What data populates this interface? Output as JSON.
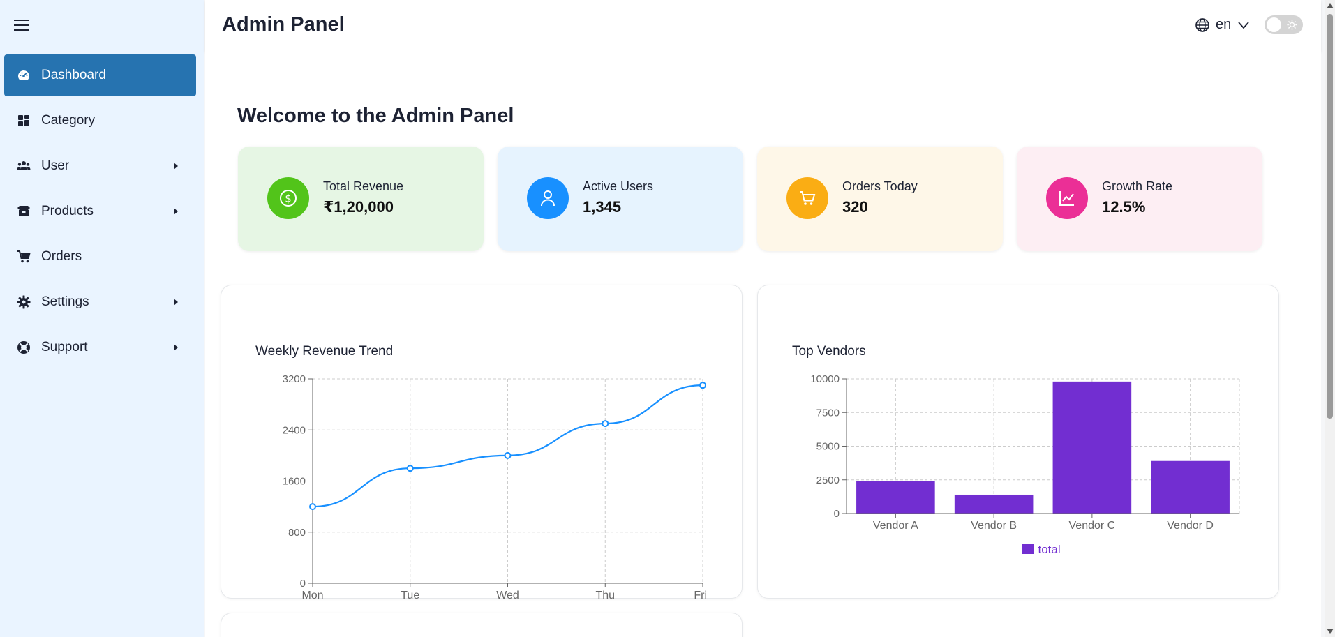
{
  "header": {
    "title": "Admin Panel",
    "language": "en",
    "language_icon": "globe-icon",
    "theme_toggle_icon": "sun-icon"
  },
  "sidebar": {
    "items": [
      {
        "label": "Dashboard",
        "icon": "gauge-icon",
        "active": true,
        "has_submenu": false
      },
      {
        "label": "Category",
        "icon": "grid-icon",
        "active": false,
        "has_submenu": false
      },
      {
        "label": "User",
        "icon": "users-icon",
        "active": false,
        "has_submenu": true
      },
      {
        "label": "Products",
        "icon": "box-icon",
        "active": false,
        "has_submenu": true
      },
      {
        "label": "Orders",
        "icon": "cart-icon",
        "active": false,
        "has_submenu": false
      },
      {
        "label": "Settings",
        "icon": "gear-icon",
        "active": false,
        "has_submenu": true
      },
      {
        "label": "Support",
        "icon": "lifebuoy-icon",
        "active": false,
        "has_submenu": true
      }
    ]
  },
  "main": {
    "welcome": "Welcome to the Admin Panel",
    "stats": [
      {
        "label": "Total Revenue",
        "value": "₹1,20,000",
        "icon": "dollar-icon",
        "color": "#52c41a",
        "bg": "#e6f6e4"
      },
      {
        "label": "Active Users",
        "value": "1,345",
        "icon": "user-icon",
        "color": "#1890ff",
        "bg": "#e6f3fe"
      },
      {
        "label": "Orders Today",
        "value": "320",
        "icon": "cart-icon",
        "color": "#faad14",
        "bg": "#fef7e8"
      },
      {
        "label": "Growth Rate",
        "value": "12.5%",
        "icon": "chart-line-icon",
        "color": "#eb2f96",
        "bg": "#fdeef3"
      }
    ]
  },
  "chart_data": [
    {
      "type": "line",
      "title": "Weekly Revenue Trend",
      "categories": [
        "Mon",
        "Tue",
        "Wed",
        "Thu",
        "Fri"
      ],
      "series": [
        {
          "values": [
            1200,
            1800,
            2000,
            2500,
            3100
          ],
          "color": "#1890ff"
        }
      ],
      "ylim": [
        0,
        3200
      ],
      "yticks": [
        0,
        800,
        1600,
        2400,
        3200
      ],
      "grid": true
    },
    {
      "type": "bar",
      "title": "Top Vendors",
      "categories": [
        "Vendor A",
        "Vendor B",
        "Vendor C",
        "Vendor D"
      ],
      "series": [
        {
          "name": "total",
          "values": [
            2400,
            1400,
            9800,
            3900
          ],
          "color": "#722ed1"
        }
      ],
      "ylim": [
        0,
        10000
      ],
      "yticks": [
        0,
        2500,
        5000,
        7500,
        10000
      ],
      "grid": true,
      "legend": "bottom"
    }
  ]
}
